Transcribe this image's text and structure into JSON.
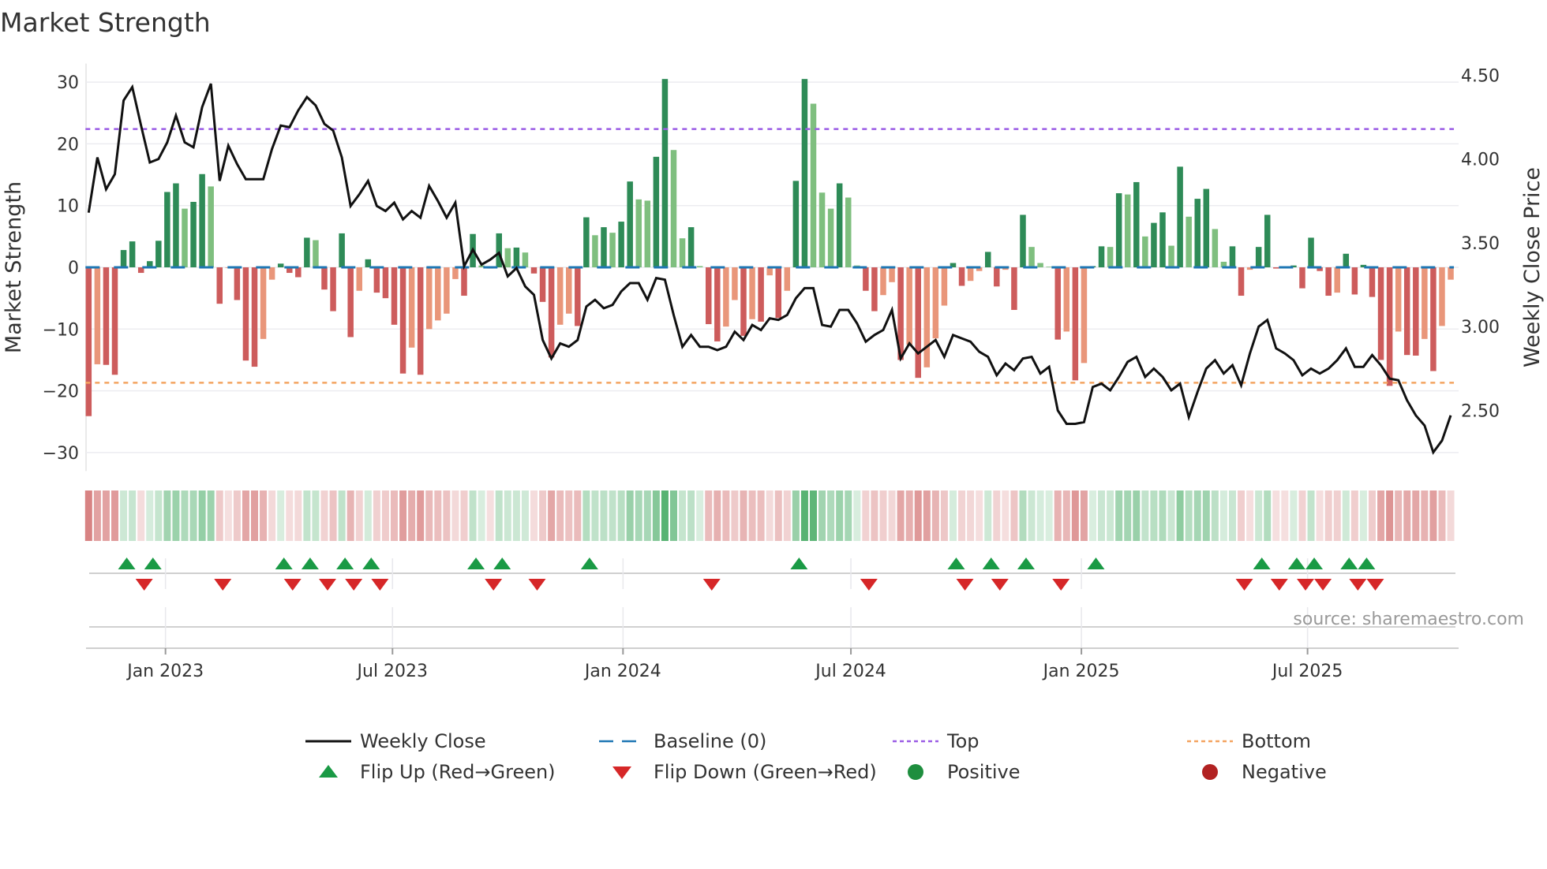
{
  "chart_data": {
    "type": "bar",
    "title": "Market Strength",
    "ylabel": "Market Strength",
    "ylabel_right": "Weekly Close Price",
    "ylim": [
      -33,
      33
    ],
    "ylim_right": [
      2.138,
      4.57
    ],
    "xlim": [
      -0.3,
      156.9
    ],
    "yticks": [
      {
        "v": 30,
        "label": "30"
      },
      {
        "v": 20,
        "label": "20"
      },
      {
        "v": 10,
        "label": "10"
      },
      {
        "v": 0,
        "label": "0"
      },
      {
        "v": -10,
        "label": "−10"
      },
      {
        "v": -20,
        "label": "−20"
      },
      {
        "v": -30,
        "label": "−30"
      }
    ],
    "yticks_right": [
      {
        "v": 4.5,
        "label": "4.50"
      },
      {
        "v": 4.0,
        "label": "4.00"
      },
      {
        "v": 3.5,
        "label": "3.50"
      },
      {
        "v": 3.0,
        "label": "3.00"
      },
      {
        "v": 2.5,
        "label": "2.50"
      }
    ],
    "xticks": [
      {
        "i": 8.8,
        "label": "Jan 2023"
      },
      {
        "i": 34.8,
        "label": "Jul 2023"
      },
      {
        "i": 61.2,
        "label": "Jan 2024"
      },
      {
        "i": 87.3,
        "label": "Jul 2024"
      },
      {
        "i": 113.7,
        "label": "Jan 2025"
      },
      {
        "i": 139.6,
        "label": "Jul 2025"
      }
    ],
    "top_level": 22.4,
    "bottom_level": -18.7,
    "baseline": 0,
    "strength": [
      -24.1,
      -15.7,
      -15.8,
      -17.4,
      2.8,
      4.2,
      -0.9,
      1.0,
      4.3,
      12.2,
      13.6,
      9.5,
      10.6,
      15.1,
      13.1,
      -5.9,
      -0.1,
      -5.3,
      -15.1,
      -16.1,
      -11.6,
      -2.0,
      0.6,
      -0.9,
      -1.6,
      4.8,
      4.4,
      -3.6,
      -7.1,
      5.5,
      -11.3,
      -3.8,
      1.3,
      -4.1,
      -5.0,
      -9.3,
      -17.2,
      -13.0,
      -17.4,
      -10.0,
      -8.6,
      -7.5,
      -1.9,
      -4.6,
      5.4,
      0.3,
      -0.2,
      5.5,
      3.1,
      3.2,
      2.4,
      -1.0,
      -5.6,
      -14.6,
      -9.3,
      -7.5,
      -9.5,
      8.1,
      5.2,
      6.5,
      5.6,
      7.4,
      13.9,
      11.0,
      10.8,
      17.9,
      30.5,
      19.0,
      4.7,
      6.5,
      0.2,
      -9.2,
      -12.0,
      -9.6,
      -5.3,
      -11.1,
      -8.4,
      -8.8,
      -1.3,
      -8.2,
      -3.8,
      14.0,
      30.5,
      26.5,
      12.1,
      9.5,
      13.6,
      11.3,
      0.3,
      -3.8,
      -7.1,
      -4.5,
      -2.4,
      -15.0,
      -12.5,
      -17.9,
      -16.2,
      -11.5,
      -6.2,
      0.7,
      -3.0,
      -2.2,
      -0.6,
      2.5,
      -3.1,
      -0.4,
      -6.9,
      8.5,
      3.3,
      0.7,
      0.1,
      -11.7,
      -10.4,
      -18.3,
      -15.5,
      0.2,
      3.4,
      3.3,
      12.0,
      11.8,
      13.8,
      5.0,
      7.2,
      8.9,
      3.5,
      16.3,
      8.2,
      11.1,
      12.7,
      6.2,
      0.9,
      3.4,
      -4.6,
      -0.4,
      3.3,
      8.5,
      -0.2,
      -0.1,
      0.3,
      -3.4,
      4.8,
      -0.6,
      -4.6,
      -4.1,
      2.2,
      -4.4,
      0.4,
      -4.8,
      -15.0,
      -19.2,
      -10.4,
      -14.2,
      -14.3,
      -11.6,
      -16.8,
      -9.5,
      -2.0
    ],
    "weekly_close": [
      3.68,
      4.01,
      3.82,
      3.91,
      4.35,
      4.43,
      4.2,
      3.98,
      4.0,
      4.1,
      4.26,
      4.1,
      4.07,
      4.31,
      4.45,
      3.87,
      4.08,
      3.97,
      3.88,
      3.88,
      3.88,
      4.06,
      4.2,
      4.19,
      4.29,
      4.37,
      4.32,
      4.21,
      4.17,
      4.01,
      3.72,
      3.79,
      3.87,
      3.72,
      3.69,
      3.74,
      3.64,
      3.69,
      3.65,
      3.84,
      3.75,
      3.65,
      3.74,
      3.36,
      3.46,
      3.37,
      3.4,
      3.44,
      3.3,
      3.35,
      3.24,
      3.19,
      2.92,
      2.81,
      2.9,
      2.88,
      2.92,
      3.12,
      3.16,
      3.11,
      3.13,
      3.21,
      3.26,
      3.26,
      3.16,
      3.29,
      3.28,
      3.07,
      2.88,
      2.95,
      2.88,
      2.88,
      2.86,
      2.88,
      2.97,
      2.92,
      3.01,
      2.98,
      3.05,
      3.04,
      3.07,
      3.17,
      3.23,
      3.23,
      3.01,
      3.0,
      3.1,
      3.1,
      3.02,
      2.91,
      2.95,
      2.98,
      3.1,
      2.81,
      2.9,
      2.84,
      2.88,
      2.92,
      2.82,
      2.95,
      2.93,
      2.91,
      2.85,
      2.82,
      2.71,
      2.78,
      2.74,
      2.81,
      2.82,
      2.72,
      2.76,
      2.5,
      2.42,
      2.42,
      2.43,
      2.64,
      2.66,
      2.62,
      2.7,
      2.79,
      2.82,
      2.7,
      2.75,
      2.7,
      2.62,
      2.66,
      2.46,
      2.61,
      2.75,
      2.8,
      2.72,
      2.77,
      2.65,
      2.84,
      3.0,
      3.04,
      2.87,
      2.84,
      2.8,
      2.71,
      2.75,
      2.72,
      2.75,
      2.8,
      2.87,
      2.76,
      2.76,
      2.83,
      2.77,
      2.69,
      2.68,
      2.56,
      2.47,
      2.41,
      2.25,
      2.32,
      2.47
    ],
    "legend": {
      "placement": "bottom",
      "items": [
        {
          "label": "Weekly Close",
          "kind": "line",
          "color": "#111111"
        },
        {
          "label": "Baseline (0)",
          "kind": "dash",
          "color": "#1f77b4"
        },
        {
          "label": "Top",
          "kind": "dot",
          "color": "#9b5de5"
        },
        {
          "label": "Bottom",
          "kind": "dot",
          "color": "#f4a460"
        },
        {
          "label": "Flip Up (Red→Green)",
          "kind": "up",
          "color": "#1a9a45"
        },
        {
          "label": "Flip Down (Green→Red)",
          "kind": "down",
          "color": "#d62728"
        },
        {
          "label": "Positive",
          "kind": "circle",
          "color": "#1e8e3e"
        },
        {
          "label": "Negative",
          "kind": "circle",
          "color": "#b22222"
        }
      ]
    },
    "source": "source: sharemaestro.com",
    "colors": {
      "pos_up": "#2e8b57",
      "pos_down": "#7fbf7f",
      "neg_down": "#cd5c5c",
      "neg_up": "#e9967a",
      "strip_pos": "46,160,80",
      "strip_neg": "200,80,80",
      "price": "#111111"
    }
  }
}
